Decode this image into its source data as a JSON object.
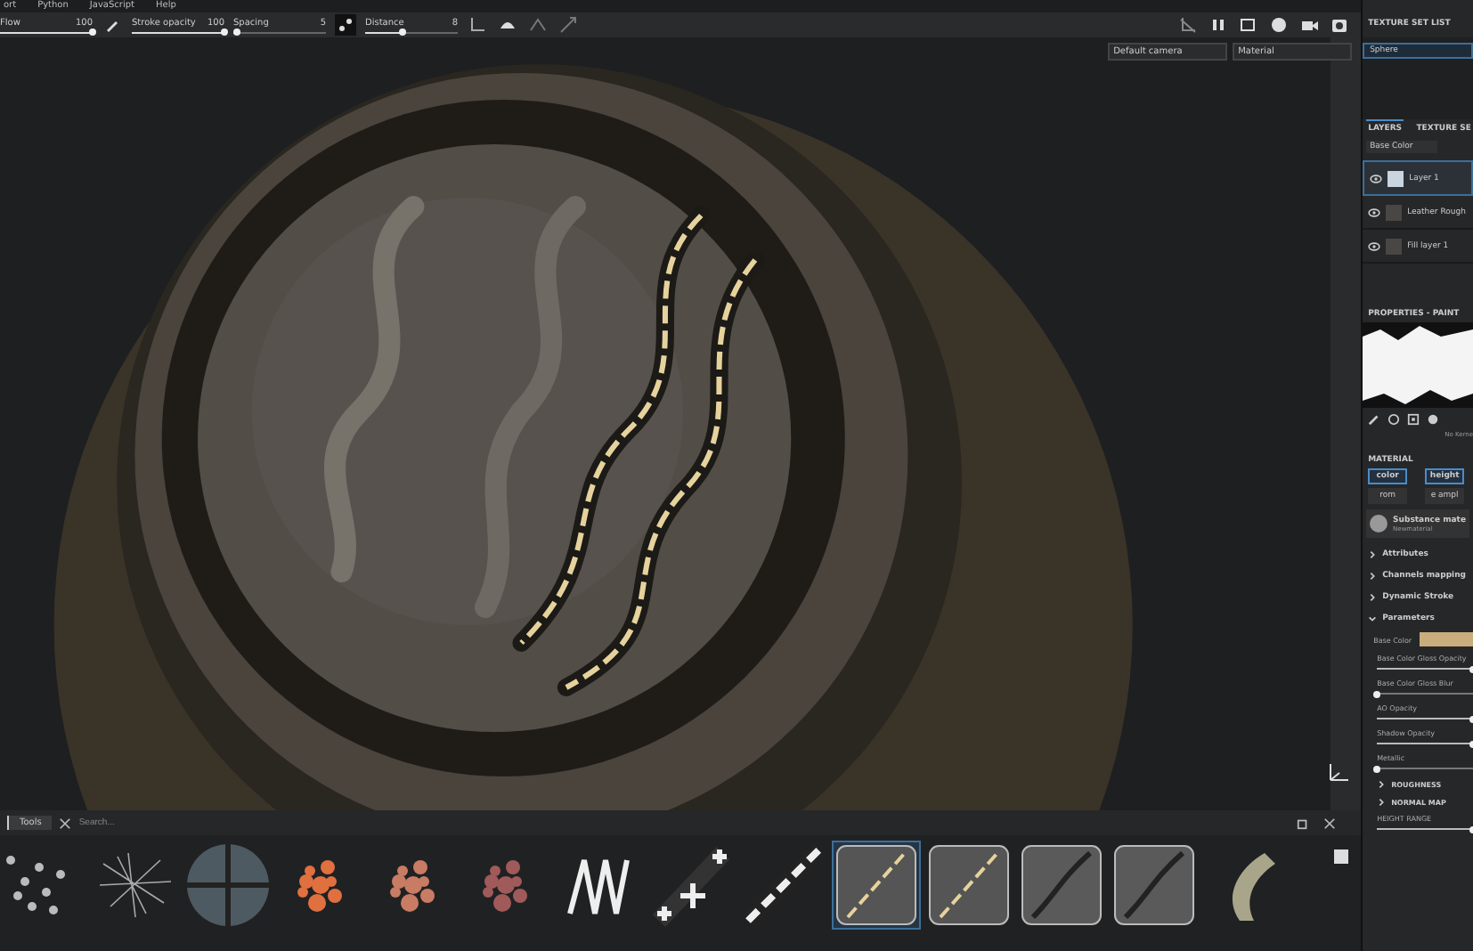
{
  "menu": [
    "ort",
    "Python",
    "JavaScript",
    "Help"
  ],
  "toolbar": {
    "sliders": [
      {
        "label": "Flow",
        "value": "100",
        "level": 1
      },
      {
        "label": "Stroke opacity",
        "value": "100",
        "level": 1
      },
      {
        "label": "Spacing",
        "value": "5",
        "level": 0.03
      },
      {
        "label": "Distance",
        "value": "8",
        "level": 0.4
      }
    ]
  },
  "viewport": {
    "camera": "Default camera",
    "mode": "Material"
  },
  "texture_set_list": {
    "title": "TEXTURE SET LIST",
    "items": [
      {
        "label": "Sphere",
        "selected": true
      }
    ]
  },
  "layers_panel": {
    "tabs": [
      {
        "label": "LAYERS",
        "selected": true
      },
      {
        "label": "TEXTURE SE",
        "selected": false
      }
    ],
    "channel": "Base Color",
    "layers": [
      {
        "name": "Layer 1",
        "selected": true,
        "kind": "paint"
      },
      {
        "name": "Leather Rough",
        "selected": false,
        "kind": "fill"
      },
      {
        "name": "Fill layer 1",
        "selected": false,
        "kind": "fill"
      }
    ]
  },
  "properties": {
    "title": "PROPERTIES - PAINT",
    "brush_caption": "No Kerne",
    "material_title": "MATERIAL",
    "channels": [
      {
        "label": "color",
        "on": true
      },
      {
        "label": "height",
        "on": true
      },
      {
        "label": "rom",
        "on": false
      },
      {
        "label": "e ampl",
        "on": false
      }
    ],
    "material_name": "Substance mate",
    "material_sub": "Newmaterial",
    "sections": [
      {
        "label": "Attributes",
        "expanded": false
      },
      {
        "label": "Channels mapping",
        "expanded": false
      },
      {
        "label": "Dynamic Stroke",
        "expanded": false
      },
      {
        "label": "Parameters",
        "expanded": true
      }
    ],
    "parameters": [
      {
        "kind": "color",
        "label": "Base Color",
        "color": "#c9ad7c"
      },
      {
        "kind": "slider",
        "label": "Base Color Gloss Opacity",
        "level": 1
      },
      {
        "kind": "slider",
        "label": "Base Color Gloss Blur",
        "level": 0
      },
      {
        "kind": "slider",
        "label": "AO Opacity",
        "level": 1
      },
      {
        "kind": "slider",
        "label": "Shadow Opacity",
        "level": 1
      },
      {
        "kind": "slider",
        "label": "Metallic",
        "level": 0
      },
      {
        "kind": "group",
        "label": "ROUGHNESS"
      },
      {
        "kind": "group",
        "label": "NORMAL MAP"
      },
      {
        "kind": "slider",
        "label": "HEIGHT RANGE",
        "level": 1
      }
    ]
  },
  "shelf": {
    "tab": "Tools",
    "search_placeholder": "Search...",
    "items": [
      {
        "kind": "dots",
        "selected": false
      },
      {
        "kind": "scratches",
        "selected": false
      },
      {
        "kind": "sphere",
        "selected": false
      },
      {
        "kind": "splatter",
        "color": "#e07040",
        "selected": false
      },
      {
        "kind": "splatter",
        "color": "#c87c64",
        "selected": false
      },
      {
        "kind": "splatter",
        "color": "#a05a5a",
        "selected": false
      },
      {
        "kind": "coil",
        "selected": false
      },
      {
        "kind": "cross",
        "selected": false
      },
      {
        "kind": "stitch",
        "selected": false
      },
      {
        "kind": "seam",
        "selected": true
      },
      {
        "kind": "seam",
        "selected": false
      },
      {
        "kind": "groove",
        "selected": false
      },
      {
        "kind": "groove",
        "selected": false
      },
      {
        "kind": "zipper",
        "selected": false
      }
    ]
  }
}
